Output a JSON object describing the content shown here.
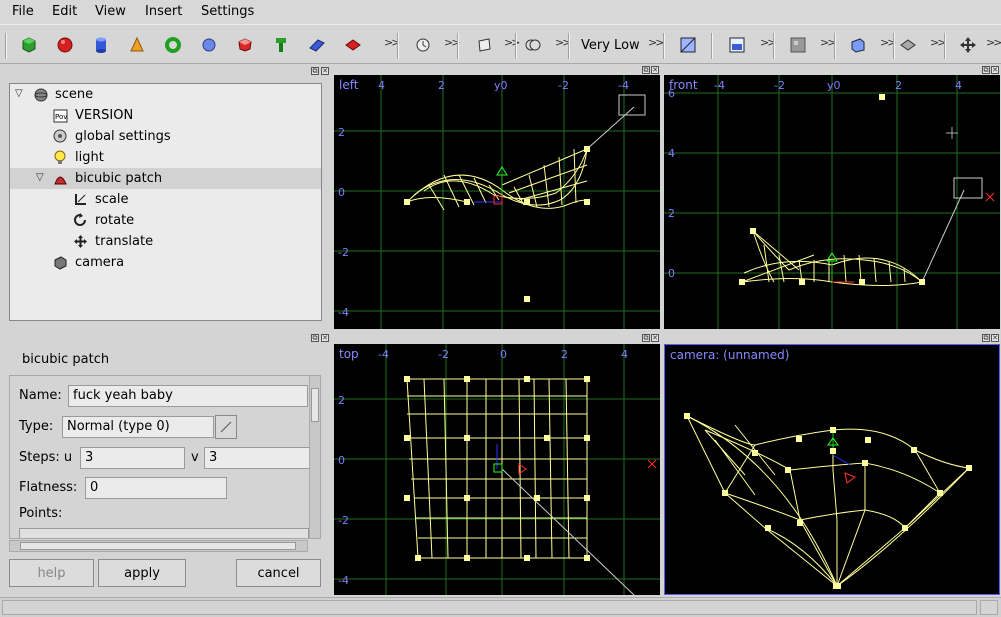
{
  "menu": [
    "File",
    "Edit",
    "View",
    "Insert",
    "Settings"
  ],
  "toolbar": {
    "tools": [
      "box-icon",
      "sphere-icon",
      "cylinder-icon",
      "cone-icon",
      "torus-icon",
      "disc-icon",
      "blob-icon",
      "lathe-icon",
      "prism-icon",
      "bicubic-patch-icon"
    ],
    "quality_label": "Very Low"
  },
  "tree": {
    "items": [
      {
        "label": "scene",
        "icon": "scene-icon"
      },
      {
        "label": "VERSION",
        "icon": "version-icon"
      },
      {
        "label": "global settings",
        "icon": "settings-icon"
      },
      {
        "label": "light",
        "icon": "light-icon"
      },
      {
        "label": "bicubic patch",
        "icon": "patch-icon"
      },
      {
        "label": "scale",
        "icon": "scale-icon"
      },
      {
        "label": "rotate",
        "icon": "rotate-icon"
      },
      {
        "label": "translate",
        "icon": "translate-icon"
      },
      {
        "label": "camera",
        "icon": "camera-icon"
      }
    ]
  },
  "properties": {
    "title": "bicubic patch",
    "name_label": "Name:",
    "name_value": "fuck yeah baby",
    "type_label": "Type:",
    "type_value": "Normal (type 0)",
    "steps_label": "Steps: u",
    "steps_u": "3",
    "steps_v_label": "v",
    "steps_v": "3",
    "flatness_label": "Flatness:",
    "flatness_value": "0",
    "points_label": "Points:"
  },
  "buttons": {
    "help": "help",
    "apply": "apply",
    "cancel": "cancel"
  },
  "views": {
    "left": {
      "label": "left",
      "ticks_x": [
        "4",
        "2",
        "y0",
        "-2",
        "-4"
      ],
      "ticks_y": [
        "2",
        "0",
        "-2",
        "-4"
      ]
    },
    "front": {
      "label": "front",
      "ticks_x": [
        "-4",
        "-2",
        "y0",
        "2",
        "4"
      ],
      "ticks_y": [
        "6",
        "4",
        "2",
        "0"
      ]
    },
    "top": {
      "label": "top",
      "ticks_x": [
        "-4",
        "-2",
        "0",
        "2",
        "4"
      ],
      "ticks_y": [
        "2",
        "0",
        "-2",
        "-4"
      ]
    },
    "camera": {
      "label": "camera: (unnamed)"
    }
  },
  "colors": {
    "wire": "#ffff99",
    "grid": "#1f6f1f",
    "axis_label": "#7f7fff",
    "handle": "#ffffa0"
  }
}
